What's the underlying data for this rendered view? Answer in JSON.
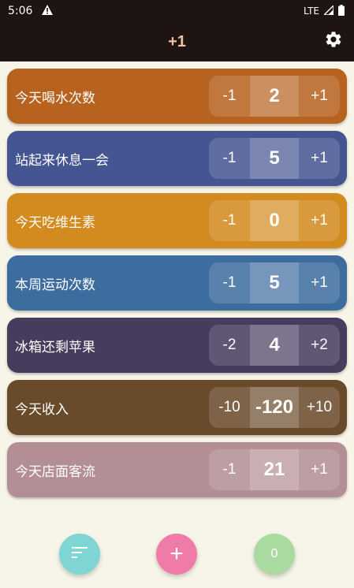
{
  "status_bar": {
    "time": "5:06",
    "warning_icon": "warning-triangle-icon",
    "network": "LTE",
    "signal_icon": "signal-icon",
    "battery_icon": "battery-icon"
  },
  "app_bar": {
    "title": "+1",
    "title_color": "#f3c1a0",
    "settings_icon": "gear-icon"
  },
  "counters": [
    {
      "name": "今天喝水次数",
      "decrement": "-1",
      "value": "2",
      "increment": "+1",
      "color": "#b7621f"
    },
    {
      "name": "站起来休息一会",
      "decrement": "-1",
      "value": "5",
      "increment": "+1",
      "color": "#455591"
    },
    {
      "name": "今天吃维生素",
      "decrement": "-1",
      "value": "0",
      "increment": "+1",
      "color": "#d38a1e"
    },
    {
      "name": "本周运动次数",
      "decrement": "-1",
      "value": "5",
      "increment": "+1",
      "color": "#3d6d9f"
    },
    {
      "name": "冰箱还剩苹果",
      "decrement": "-2",
      "value": "4",
      "increment": "+2",
      "color": "#463c5e"
    },
    {
      "name": "今天收入",
      "decrement": "-10",
      "value": "-120",
      "increment": "+10",
      "color": "#694a2a"
    },
    {
      "name": "今天店面客流",
      "decrement": "-1",
      "value": "21",
      "increment": "+1",
      "color": "#b38f95"
    }
  ],
  "fabs": {
    "sort": {
      "icon": "sort-icon",
      "color": "#7fd5d3"
    },
    "add": {
      "label": "+",
      "icon": "plus-icon",
      "color": "#f07aa8"
    },
    "count": {
      "label": "0",
      "color": "#a9dba0"
    }
  }
}
